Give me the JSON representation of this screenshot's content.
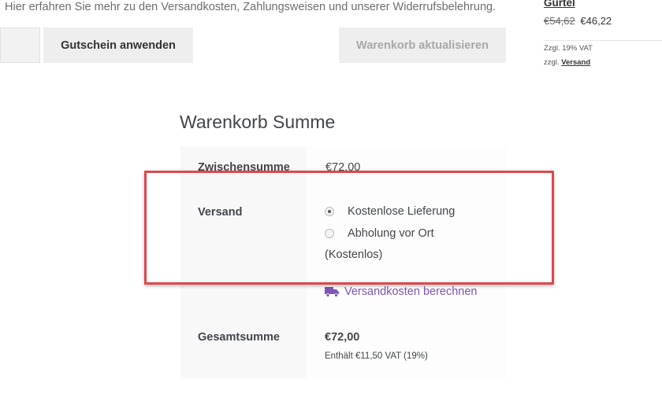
{
  "notice": {
    "prefix": "Hier erfahren Sie mehr zu den",
    "shipping_link": "Versandkosten",
    "sep1": ",",
    "payment_link": "Zahlungsweisen",
    "middle": "und unserer",
    "withdrawal_link": "Widerrufsbelehrung",
    "suffix": "."
  },
  "coupon": {
    "input_value": "",
    "apply_label": "Gutschein anwenden"
  },
  "cart": {
    "update_label": "Warenkorb aktualisieren"
  },
  "side_product": {
    "title": "Gürtel",
    "old_price": "€54,62",
    "new_price": "€46,22",
    "vat_note": "Zzgl. 19% VAT",
    "shipping_prefix": "zzgl.",
    "shipping_link": "Versand"
  },
  "totals": {
    "heading": "Warenkorb Summe",
    "subtotal_label": "Zwischensumme",
    "subtotal_value": "€72,00",
    "shipping_label": "Versand",
    "shipping_options": [
      {
        "label": "Kostenlose Lieferung",
        "checked": true
      },
      {
        "label": "Abholung vor Ort",
        "checked": false
      }
    ],
    "shipping_option2_note": "(Kostenlos)",
    "calc_link": "Versandkosten berechnen",
    "total_label": "Gesamtsumme",
    "total_value": "€72,00",
    "tax_note": "Enthält €11,50 VAT (19%)"
  },
  "icons": {
    "truck": "truck-icon",
    "radio_checked": "radio-checked-icon",
    "radio_unchecked": "radio-unchecked-icon"
  },
  "colors": {
    "link_purple": "#7f54b3",
    "highlight_red": "#e0464c",
    "button_bg": "#eeeeee"
  }
}
